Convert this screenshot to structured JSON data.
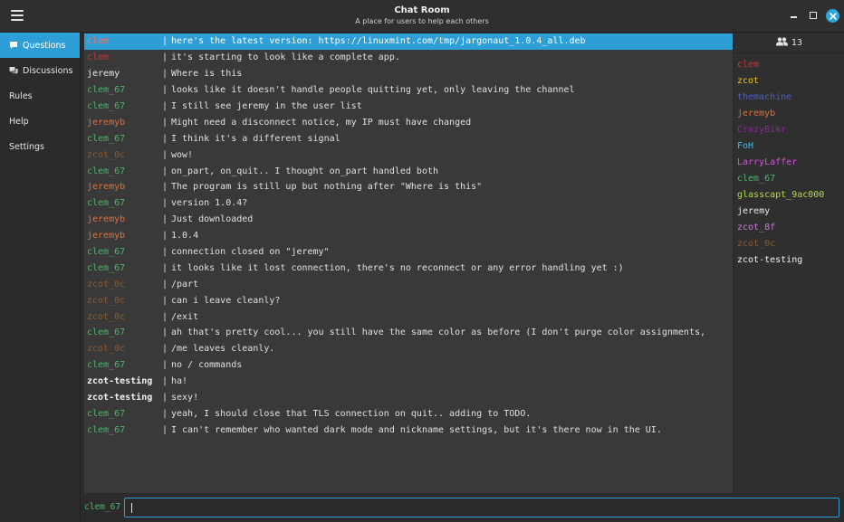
{
  "window": {
    "title": "Chat Room",
    "subtitle": "A place for users to help each others",
    "controls": [
      "minimize-icon",
      "maximize-icon",
      "close-icon"
    ],
    "accent_color": "#2d9ed6"
  },
  "sidebar": {
    "items": [
      {
        "label": "Questions",
        "icon": "chat-bubble-icon",
        "active": true
      },
      {
        "label": "Discussions",
        "icon": "chat-bubbles-icon",
        "active": false
      },
      {
        "label": "Rules",
        "icon": "",
        "active": false
      },
      {
        "label": "Help",
        "icon": "",
        "active": false
      },
      {
        "label": "Settings",
        "icon": "",
        "active": false
      }
    ]
  },
  "messages": [
    {
      "nick": "clem",
      "color": "#e0413a",
      "text": "here's the latest version: https://linuxmint.com/tmp/jargonaut_1.0.4_all.deb",
      "highlight": true
    },
    {
      "nick": "clem",
      "color": "#c6373a",
      "text": "it's starting to look like a complete app."
    },
    {
      "nick": "jeremy",
      "color": "#e8e8e8",
      "text": "Where is this"
    },
    {
      "nick": "clem_67",
      "color": "#4fb36b",
      "text": "looks like it doesn't handle people quitting yet, only leaving the channel"
    },
    {
      "nick": "clem_67",
      "color": "#4fb36b",
      "text": "I still see jeremy in the user list"
    },
    {
      "nick": "jeremyb",
      "color": "#e2703a",
      "text": "Might need a disconnect notice, my IP must have changed"
    },
    {
      "nick": "clem_67",
      "color": "#4fb36b",
      "text": "I think it's a different signal"
    },
    {
      "nick": "zcot_0c",
      "color": "#8a5a2f",
      "text": "wow!"
    },
    {
      "nick": "clem_67",
      "color": "#4fb36b",
      "text": "on_part, on_quit.. I thought on_part handled both"
    },
    {
      "nick": "jeremyb",
      "color": "#e2703a",
      "text": "The program is still up but nothing after \"Where is this\""
    },
    {
      "nick": "clem_67",
      "color": "#4fb36b",
      "text": "version 1.0.4?"
    },
    {
      "nick": "jeremyb",
      "color": "#e2703a",
      "text": "Just downloaded"
    },
    {
      "nick": "jeremyb",
      "color": "#e2703a",
      "text": "1.0.4"
    },
    {
      "nick": "clem_67",
      "color": "#4fb36b",
      "text": "connection closed on \"jeremy\""
    },
    {
      "nick": "clem_67",
      "color": "#4fb36b",
      "text": "it looks like it lost connection, there's no reconnect or any error handling yet :)"
    },
    {
      "nick": "zcot_0c",
      "color": "#8a5a2f",
      "text": "/part"
    },
    {
      "nick": "zcot_0c",
      "color": "#8a5a2f",
      "text": "can i leave cleanly?"
    },
    {
      "nick": "zcot_0c",
      "color": "#8a5a2f",
      "text": "/exit"
    },
    {
      "nick": "clem_67",
      "color": "#4fb36b",
      "text": "ah that's pretty cool... you still have the same color as before (I don't purge color assignments,"
    },
    {
      "nick": "zcot_0c",
      "color": "#8a5a2f",
      "text": "/me leaves cleanly."
    },
    {
      "nick": "clem_67",
      "color": "#4fb36b",
      "text": "no / commands"
    },
    {
      "nick": "zcot-testing",
      "color": "#f2f2f2",
      "bold": true,
      "text": "ha!"
    },
    {
      "nick": "zcot-testing",
      "color": "#f2f2f2",
      "bold": true,
      "text": "sexy!"
    },
    {
      "nick": "clem_67",
      "color": "#4fb36b",
      "text": "yeah, I should close that TLS connection on quit.. adding to TODO."
    },
    {
      "nick": "clem_67",
      "color": "#4fb36b",
      "text": "I can't remember who wanted dark mode and nickname settings, but it's there now in the UI."
    }
  ],
  "userlist": {
    "count": "13",
    "count_icon": "users-icon",
    "users": [
      {
        "nick": "clem",
        "color": "#c6373a"
      },
      {
        "nick": "zcot",
        "color": "#f0c419"
      },
      {
        "nick": "themachine",
        "color": "#4a5fc4"
      },
      {
        "nick": "jeremyb",
        "color": "#e2703a"
      },
      {
        "nick": "CrazyBikr",
        "color": "#8b2c9a"
      },
      {
        "nick": "FoH",
        "color": "#3fb8e8"
      },
      {
        "nick": "LarryLaffer",
        "color": "#d24fd8"
      },
      {
        "nick": "clem_67",
        "color": "#4fb36b"
      },
      {
        "nick": "glasscapt_9ac000",
        "color": "#b3d94a"
      },
      {
        "nick": "jeremy",
        "color": "#e8e8e8"
      },
      {
        "nick": "zcot_8f",
        "color": "#c77ad8"
      },
      {
        "nick": "zcot_0c",
        "color": "#8a5a2f"
      },
      {
        "nick": "zcot-testing",
        "color": "#f2f2f2"
      }
    ]
  },
  "input": {
    "own_nick": "clem_67",
    "value": ""
  },
  "separator": "|"
}
